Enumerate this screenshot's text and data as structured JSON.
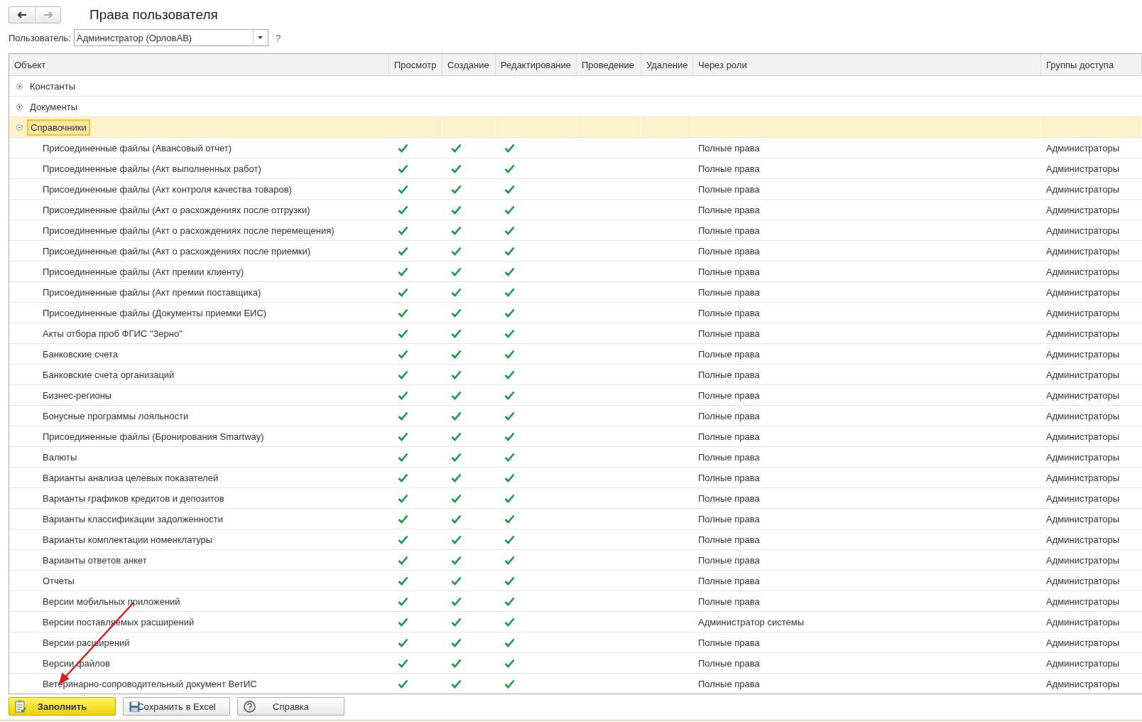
{
  "title": "Права пользователя",
  "user": {
    "label": "Пользователь:",
    "value": "Администратор (ОрловАВ)",
    "help": "?"
  },
  "columns": [
    "Объект",
    "Просмотр",
    "Создание",
    "Редактирование",
    "Проведение",
    "Удаление",
    "Через роли",
    "Группы доступа"
  ],
  "groups": [
    {
      "label": "Константы",
      "expanded": false,
      "selected": false
    },
    {
      "label": "Документы",
      "expanded": false,
      "selected": false
    },
    {
      "label": "Справочники",
      "expanded": true,
      "selected": true,
      "children": [
        {
          "name": "Присоединенные файлы (Авансовый отчет)",
          "view": true,
          "create": true,
          "edit": true,
          "roles": "Полные права",
          "access": "Администраторы"
        },
        {
          "name": "Присоединенные файлы (Акт выполненных работ)",
          "view": true,
          "create": true,
          "edit": true,
          "roles": "Полные права",
          "access": "Администраторы"
        },
        {
          "name": "Присоединенные файлы (Акт контроля качества товаров)",
          "view": true,
          "create": true,
          "edit": true,
          "roles": "Полные права",
          "access": "Администраторы"
        },
        {
          "name": "Присоединенные файлы (Акт о расхождениях после отгрузки)",
          "view": true,
          "create": true,
          "edit": true,
          "roles": "Полные права",
          "access": "Администраторы"
        },
        {
          "name": "Присоединенные файлы (Акт о расхождениях после перемещения)",
          "view": true,
          "create": true,
          "edit": true,
          "roles": "Полные права",
          "access": "Администраторы"
        },
        {
          "name": "Присоединенные файлы (Акт о расхождениях после приемки)",
          "view": true,
          "create": true,
          "edit": true,
          "roles": "Полные права",
          "access": "Администраторы"
        },
        {
          "name": "Присоединенные файлы (Акт премии клиенту)",
          "view": true,
          "create": true,
          "edit": true,
          "roles": "Полные права",
          "access": "Администраторы"
        },
        {
          "name": "Присоединенные файлы (Акт премии поставщика)",
          "view": true,
          "create": true,
          "edit": true,
          "roles": "Полные права",
          "access": "Администраторы"
        },
        {
          "name": "Присоединенные файлы (Документы приемки ЕИС)",
          "view": true,
          "create": true,
          "edit": true,
          "roles": "Полные права",
          "access": "Администраторы"
        },
        {
          "name": "Акты отбора проб ФГИС \"Зерно\"",
          "view": true,
          "create": true,
          "edit": true,
          "roles": "Полные права",
          "access": "Администраторы"
        },
        {
          "name": "Банковские счета",
          "view": true,
          "create": true,
          "edit": true,
          "roles": "Полные права",
          "access": "Администраторы"
        },
        {
          "name": "Банковские счета организаций",
          "view": true,
          "create": true,
          "edit": true,
          "roles": "Полные права",
          "access": "Администраторы"
        },
        {
          "name": "Бизнес-регионы",
          "view": true,
          "create": true,
          "edit": true,
          "roles": "Полные права",
          "access": "Администраторы"
        },
        {
          "name": "Бонусные программы лояльности",
          "view": true,
          "create": true,
          "edit": true,
          "roles": "Полные права",
          "access": "Администраторы"
        },
        {
          "name": "Присоединенные файлы (Бронирования Smartway)",
          "view": true,
          "create": true,
          "edit": true,
          "roles": "Полные права",
          "access": "Администраторы"
        },
        {
          "name": "Валюты",
          "view": true,
          "create": true,
          "edit": true,
          "roles": "Полные права",
          "access": "Администраторы"
        },
        {
          "name": "Варианты анализа целевых показателей",
          "view": true,
          "create": true,
          "edit": true,
          "roles": "Полные права",
          "access": "Администраторы"
        },
        {
          "name": "Варианты графиков кредитов и депозитов",
          "view": true,
          "create": true,
          "edit": true,
          "roles": "Полные права",
          "access": "Администраторы"
        },
        {
          "name": "Варианты классификации задолженности",
          "view": true,
          "create": true,
          "edit": true,
          "roles": "Полные права",
          "access": "Администраторы"
        },
        {
          "name": "Варианты комплектации номенклатуры",
          "view": true,
          "create": true,
          "edit": true,
          "roles": "Полные права",
          "access": "Администраторы"
        },
        {
          "name": "Варианты ответов анкет",
          "view": true,
          "create": true,
          "edit": true,
          "roles": "Полные права",
          "access": "Администраторы"
        },
        {
          "name": "Отчеты",
          "view": true,
          "create": true,
          "edit": true,
          "roles": "Полные права",
          "access": "Администраторы"
        },
        {
          "name": "Версии мобильных приложений",
          "view": true,
          "create": true,
          "edit": true,
          "roles": "Полные права",
          "access": "Администраторы"
        },
        {
          "name": "Версии поставляемых расширений",
          "view": true,
          "create": true,
          "edit": true,
          "roles": "Администратор системы",
          "access": "Администраторы"
        },
        {
          "name": "Версии расширений",
          "view": true,
          "create": true,
          "edit": true,
          "roles": "Полные права",
          "access": "Администраторы"
        },
        {
          "name": "Версии файлов",
          "view": true,
          "create": true,
          "edit": true,
          "roles": "Полные права",
          "access": "Администраторы"
        },
        {
          "name": "Ветеринарно-сопроводительный документ ВетИС",
          "view": true,
          "create": true,
          "edit": true,
          "roles": "Полные права",
          "access": "Администраторы"
        }
      ]
    }
  ],
  "buttons": [
    {
      "kind": "primary",
      "label": "Заполнить"
    },
    {
      "kind": "excel",
      "label": "Сохранить в Excel"
    },
    {
      "kind": "help",
      "label": "Справка"
    }
  ],
  "annotation": {
    "kind": "arrow"
  }
}
